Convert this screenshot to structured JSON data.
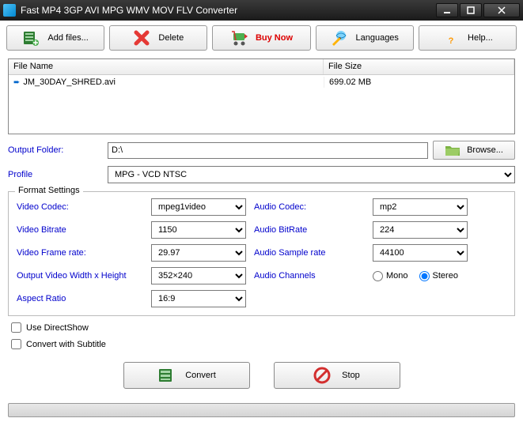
{
  "window": {
    "title": "Fast MP4 3GP AVI MPG WMV MOV FLV Converter"
  },
  "toolbar": {
    "add_files": "Add files...",
    "delete": "Delete",
    "buy_now": "Buy Now",
    "languages": "Languages",
    "help": "Help..."
  },
  "file_table": {
    "headers": {
      "name": "File Name",
      "size": "File Size"
    },
    "rows": [
      {
        "name": "JM_30DAY_SHRED.avi",
        "size": "699.02 MB"
      }
    ]
  },
  "output": {
    "folder_label": "Output Folder:",
    "folder_value": "D:\\",
    "browse": "Browse...",
    "profile_label": "Profile",
    "profile_value": "MPG - VCD NTSC"
  },
  "format": {
    "legend": "Format Settings",
    "video_codec_label": "Video Codec:",
    "video_codec": "mpeg1video",
    "video_bitrate_label": "Video Bitrate",
    "video_bitrate": "1150",
    "video_fps_label": "Video Frame rate:",
    "video_fps": "29.97",
    "video_size_label": "Output Video Width x Height",
    "video_size": "352×240",
    "aspect_label": "Aspect Ratio",
    "aspect": "16:9",
    "audio_codec_label": "Audio Codec:",
    "audio_codec": "mp2",
    "audio_bitrate_label": "Audio BitRate",
    "audio_bitrate": "224",
    "audio_sample_label": "Audio Sample rate",
    "audio_sample": "44100",
    "audio_channels_label": "Audio Channels",
    "mono": "Mono",
    "stereo": "Stereo"
  },
  "options": {
    "directshow": "Use DirectShow",
    "subtitle": "Convert with Subtitle"
  },
  "actions": {
    "convert": "Convert",
    "stop": "Stop"
  }
}
